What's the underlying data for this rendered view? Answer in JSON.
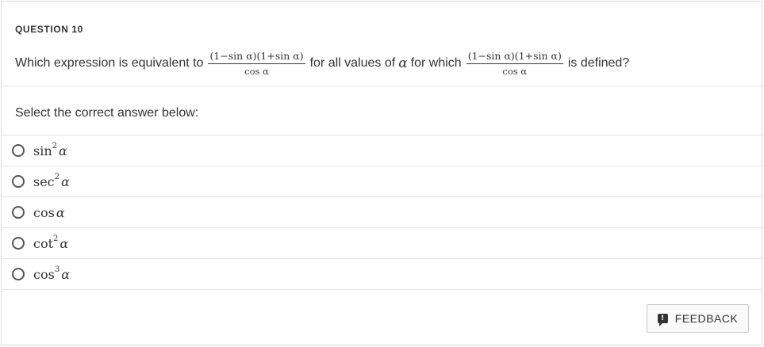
{
  "question": {
    "header": "QUESTION 10",
    "stem_prefix": "Which expression is equivalent to",
    "stem_mid": "for all values of",
    "stem_mid2": "for which",
    "stem_suffix": "is defined?",
    "fraction_numerator": "(1−sin α)(1+sin α)",
    "fraction_denominator": "cos α",
    "variable": "α"
  },
  "prompt": "Select the correct answer below:",
  "options": [
    {
      "func": "sin",
      "power": "2",
      "var": "α"
    },
    {
      "func": "sec",
      "power": "2",
      "var": "α"
    },
    {
      "func": "cos",
      "power": "",
      "var": "α"
    },
    {
      "func": "cot",
      "power": "2",
      "var": "α"
    },
    {
      "func": "cos",
      "power": "3",
      "var": "α"
    }
  ],
  "feedback": {
    "label": "FEEDBACK",
    "icon": "feedback-icon",
    "icon_glyph": "!"
  }
}
